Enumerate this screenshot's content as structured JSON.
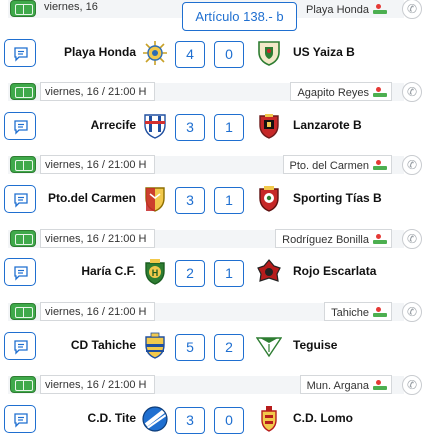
{
  "article_button": "Artículo 138.- b",
  "entries": [
    {
      "date": "viernes, 16",
      "venue": "Playa Honda",
      "home": "Playa Honda",
      "home_score": "4",
      "away_score": "0",
      "away": "US Yaiza B"
    },
    {
      "date": "viernes, 16 / 21:00 H",
      "venue": "Agapito Reyes",
      "home": "Arrecife",
      "home_score": "3",
      "away_score": "1",
      "away": "Lanzarote B"
    },
    {
      "date": "viernes, 16 / 21:00 H",
      "venue": "Pto. del Carmen",
      "home": "Pto.del Carmen",
      "home_score": "3",
      "away_score": "1",
      "away": "Sporting Tías B"
    },
    {
      "date": "viernes, 16 / 21:00 H",
      "venue": "Rodríguez Bonilla",
      "home": "Haría C.F.",
      "home_score": "2",
      "away_score": "1",
      "away": "Rojo Escarlata"
    },
    {
      "date": "viernes, 16 / 21:00 H",
      "venue": "Tahiche",
      "home": "CD Tahiche",
      "home_score": "5",
      "away_score": "2",
      "away": "Teguise"
    },
    {
      "date": "viernes, 16 / 21:00 H",
      "venue": "Mun. Argana",
      "home": "C.D. Tite",
      "home_score": "3",
      "away_score": "0",
      "away": "C.D. Lomo"
    }
  ],
  "icons": {
    "field": "soccer-field-icon",
    "venue": "stadium-icon",
    "phone": "phone-icon",
    "chat": "chat-icon"
  },
  "colors": {
    "accent": "#1f6fd0",
    "field_green": "#3fa94a",
    "strip": "#f3f5f7",
    "border": "#d5d8db"
  }
}
